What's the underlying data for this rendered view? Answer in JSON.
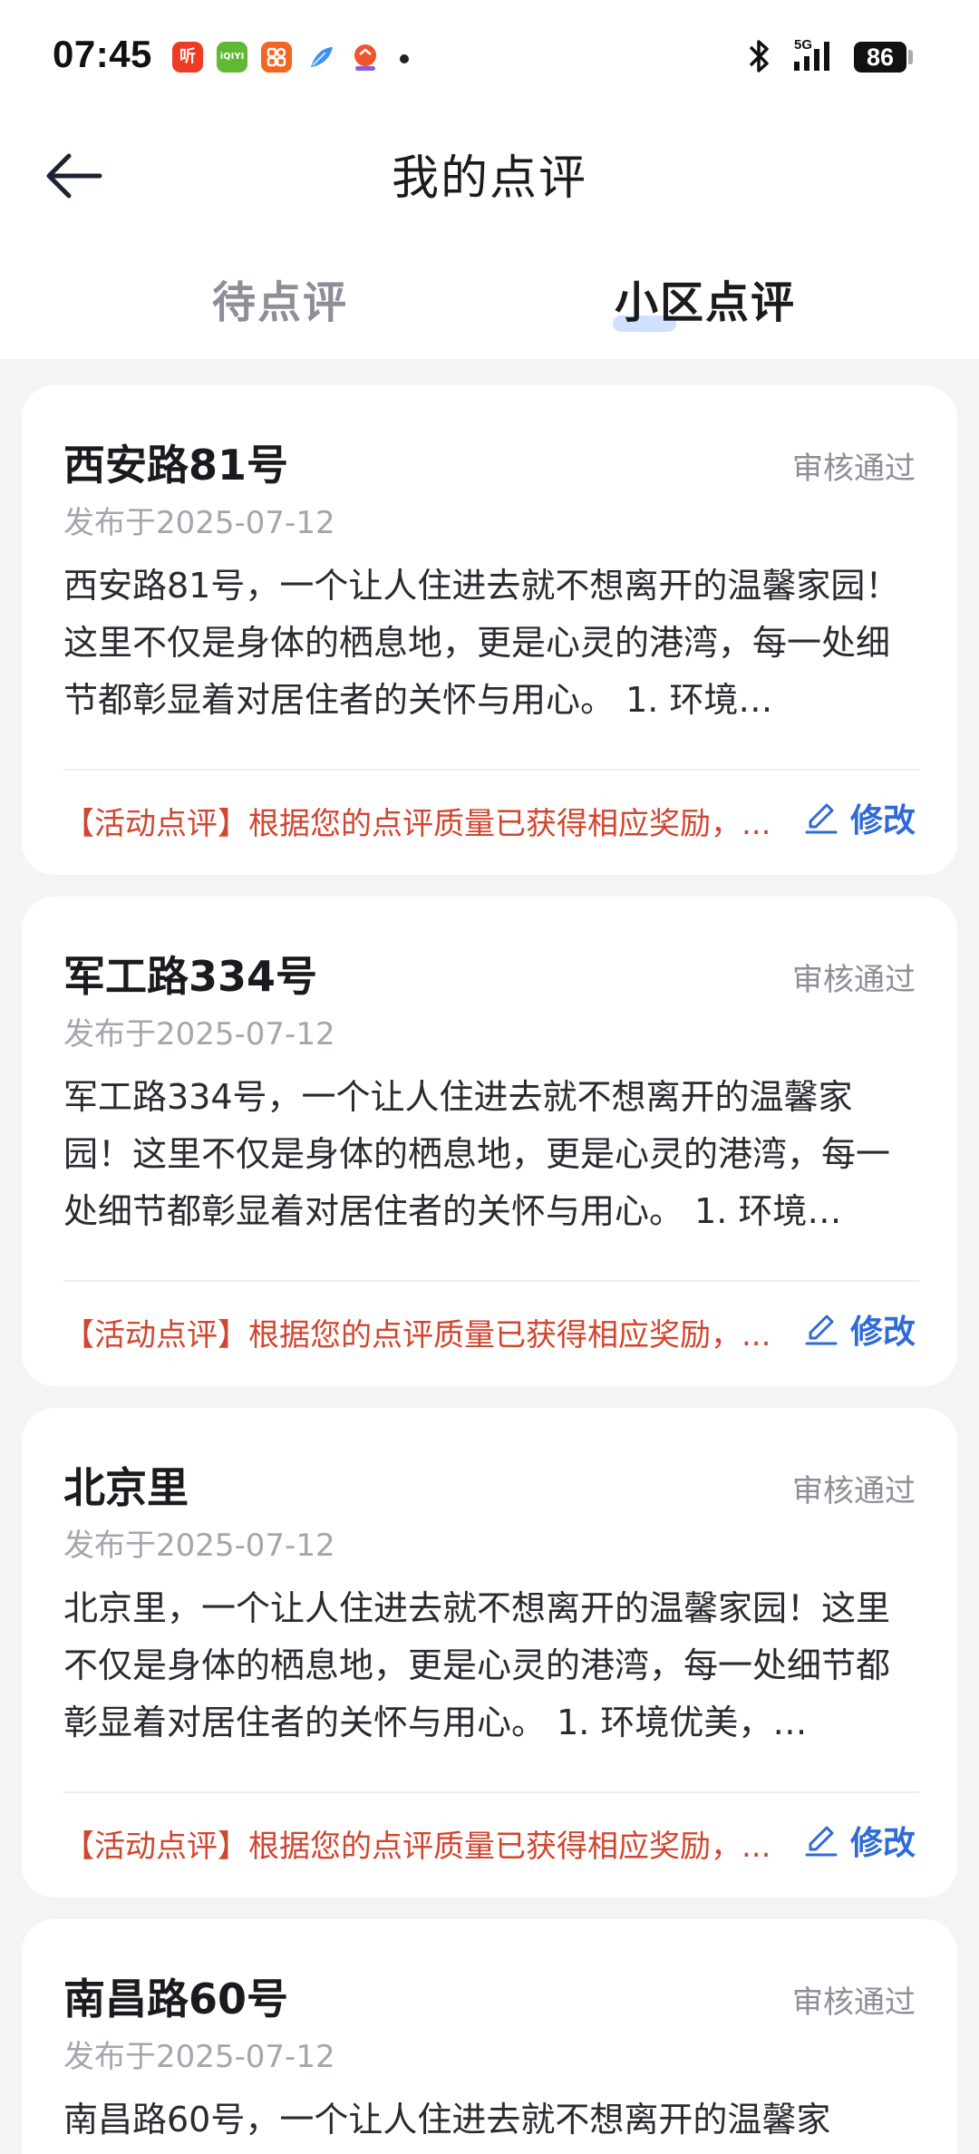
{
  "status_bar": {
    "time": "07:45",
    "apps": [
      {
        "icon": "ting-app-icon",
        "label": "听",
        "color": "#ee3b24"
      },
      {
        "icon": "iqiyi-app-icon",
        "label": "iQIYI",
        "color": "#5fb935"
      },
      {
        "icon": "app-grid-icon",
        "label": "",
        "color": "#f26522"
      },
      {
        "icon": "feather-app-icon",
        "label": "",
        "color": "#3d8ff0"
      },
      {
        "icon": "shop-app-icon",
        "label": "",
        "color": "#f0542c"
      }
    ],
    "network": "5G",
    "battery": "86"
  },
  "header": {
    "title": "我的点评",
    "tabs": [
      {
        "label": "待点评",
        "active": false
      },
      {
        "label": "小区点评",
        "active": true
      }
    ]
  },
  "reviews": [
    {
      "title": "西安路81号",
      "status": "审核通过",
      "date": "发布于2025-07-12",
      "body": "西安路81号，一个让人住进去就不想离开的温馨家园！这里不仅是身体的栖息地，更是心灵的港湾，每一处细节都彰显着对居住者的关怀与用心。 1. 环境…",
      "activity": "【活动点评】根据您的点评质量已获得相应奖励，...",
      "edit_label": "修改"
    },
    {
      "title": "军工路334号",
      "status": "审核通过",
      "date": "发布于2025-07-12",
      "body": "军工路334号，一个让人住进去就不想离开的温馨家园！这里不仅是身体的栖息地，更是心灵的港湾，每一处细节都彰显着对居住者的关怀与用心。 1. 环境…",
      "activity": "【活动点评】根据您的点评质量已获得相应奖励，...",
      "edit_label": "修改"
    },
    {
      "title": "北京里",
      "status": "审核通过",
      "date": "发布于2025-07-12",
      "body": "北京里，一个让人住进去就不想离开的温馨家园！这里不仅是身体的栖息地，更是心灵的港湾，每一处细节都彰显着对居住者的关怀与用心。 1. 环境优美，…",
      "activity": "【活动点评】根据您的点评质量已获得相应奖励，...",
      "edit_label": "修改"
    },
    {
      "title": "南昌路60号",
      "status": "审核通过",
      "date": "发布于2025-07-12",
      "body": "南昌路60号，一个让人住进去就不想离开的温馨家",
      "activity": "",
      "edit_label": ""
    }
  ]
}
